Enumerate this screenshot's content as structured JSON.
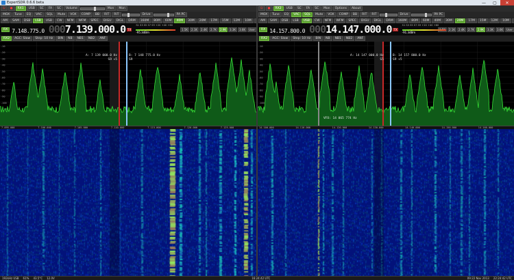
{
  "window": {
    "title": "ExpertSDR 0.6.6 beta",
    "min": "—",
    "max": "▢",
    "close": "✕"
  },
  "receivers": [
    {
      "row1": [
        "RX1",
        "USB",
        "SC",
        "FA",
        "SC",
        "Volume",
        "Mon",
        "Mon"
      ],
      "row2": [
        "MOX",
        "Tune",
        "EQ",
        "VAC",
        "SQL",
        "Mute",
        "VOX",
        "COMP",
        "BB",
        "RIT",
        "RIT",
        "Drive",
        "PA PC"
      ],
      "row3": [
        "AM",
        "SAM",
        "DSB",
        "LSB",
        "USB",
        "CW",
        "NFM",
        "WFM",
        "SPEC",
        "DIGU",
        "DIGL",
        "DRM",
        "160M",
        "80M",
        "60M",
        "40M",
        "30M",
        "20M",
        "17M",
        "15M",
        "12M",
        "10M",
        "6M",
        "2M",
        "GEN"
      ],
      "row3_active_mode": "LSB",
      "row3_active_band": "40M",
      "vfo_small": "7.148.775.0",
      "vfo_main_dim": "000",
      "vfo_main": "7.139.000.0",
      "sm_dbm": "-95.3dBm",
      "sm_scale": "S1 S3 S5 S7 S9 +20 +40 +60",
      "bands": [
        "160M",
        "80M",
        "60M",
        "40M",
        "30M",
        "20M",
        "17M",
        "15M",
        "12M",
        "10M",
        "6M",
        "2M",
        "1.5K",
        "2.1K",
        "2.4K",
        "2.7K",
        "2.9K",
        "3.3K",
        "3.6K",
        "User"
      ],
      "ctrl": [
        "RX2",
        "AGC: Slow",
        "Step: 10 Hz",
        "BIN",
        "NB",
        "NB1",
        "NB2",
        "ANF"
      ],
      "info_a": "A: 7 139 000.0 Hz",
      "info_a_sig": "S9 +5",
      "info_b": "B: 7 148 775.0 Hz",
      "info_b_sig": "S9",
      "axis": [
        "7.095.000",
        "7.100.000",
        "7.105.000",
        "7.110.000",
        "7.115.000",
        "7.120.000",
        "7.125.000"
      ],
      "db_ticks": [
        "-10",
        "-20",
        "-30",
        "-40",
        "-50",
        "-60",
        "-70",
        "-80",
        "-90",
        "-100",
        "-110",
        "-120",
        "-130"
      ]
    },
    {
      "row1": [
        "RX2",
        "USB",
        "SC",
        "FA",
        "SC",
        "Mon",
        "Options",
        "About"
      ],
      "row2": [
        "MOX",
        "Tune",
        "EQ",
        "VAC",
        "SQL",
        "Mute",
        "VOX",
        "COMP",
        "BB",
        "RIT",
        "RIT",
        "Drive",
        "PA PC"
      ],
      "row3": [
        "AM",
        "SAM",
        "DSB",
        "LSB",
        "USB",
        "CW",
        "NFM",
        "WFM",
        "SPEC",
        "DIGU",
        "DIGL",
        "DRM",
        "160M",
        "80M",
        "60M",
        "40M",
        "30M",
        "20M",
        "17M",
        "15M",
        "12M",
        "10M",
        "6M",
        "2M",
        "GEN"
      ],
      "row3_active_mode": "USB",
      "row3_active_band": "20M",
      "vfo_small": "14.157.800.0",
      "vfo_main_dim": "000",
      "vfo_main": "14.147.000.0",
      "sm_dbm": "-91.3dBm",
      "sm_scale": "S1 S3 S5 S7 S9 +20 +40 +60",
      "bands": [
        "160M",
        "80M",
        "60M",
        "40M",
        "30M",
        "20M",
        "17M",
        "15M",
        "12M",
        "10M",
        "6M",
        "2M",
        "1.5K",
        "2.1K",
        "2.4K",
        "2.7K",
        "2.9K",
        "3.3K",
        "3.6K",
        "User"
      ],
      "ctrl": [
        "RX2",
        "AGC: Slow",
        "Step: 10 Hz",
        "BIN",
        "NB",
        "NB1",
        "NB2",
        "ANF"
      ],
      "info_a": "A: 14 147 000.0 Hz",
      "info_a_sig": "S5",
      "info_b": "B: 14 157 800.0 Hz",
      "info_b_sig": "S9 +5",
      "info_vfo": "VFO: 14 065 774 Hz",
      "axis": [
        "14.100.000",
        "14.110.000",
        "14.120.000",
        "14.130.000",
        "14.140.000",
        "14.150.000",
        "14.160.000"
      ],
      "db_ticks": [
        "-10",
        "-20",
        "-30",
        "-40",
        "-50",
        "-60",
        "-70",
        "-80",
        "-90",
        "-100",
        "-110",
        "-120",
        "-130"
      ]
    }
  ],
  "statusbar": {
    "sample": "192kHz USB",
    "cpu": "61%",
    "temp": "43.5°C",
    "voltage": "12.0V",
    "center": "16:24:42 UTC",
    "date": "09:22 Nov 2013",
    "time": "22:24:42 UTC"
  },
  "colors": {
    "spectrum_line": "#36e036",
    "spectrum_fill": "#0f5a18",
    "marker_red": "#c82828",
    "marker_blue": "#8cc8ff",
    "waterfall_bg": "#03127a",
    "accent_green": "#5a9f2e"
  }
}
